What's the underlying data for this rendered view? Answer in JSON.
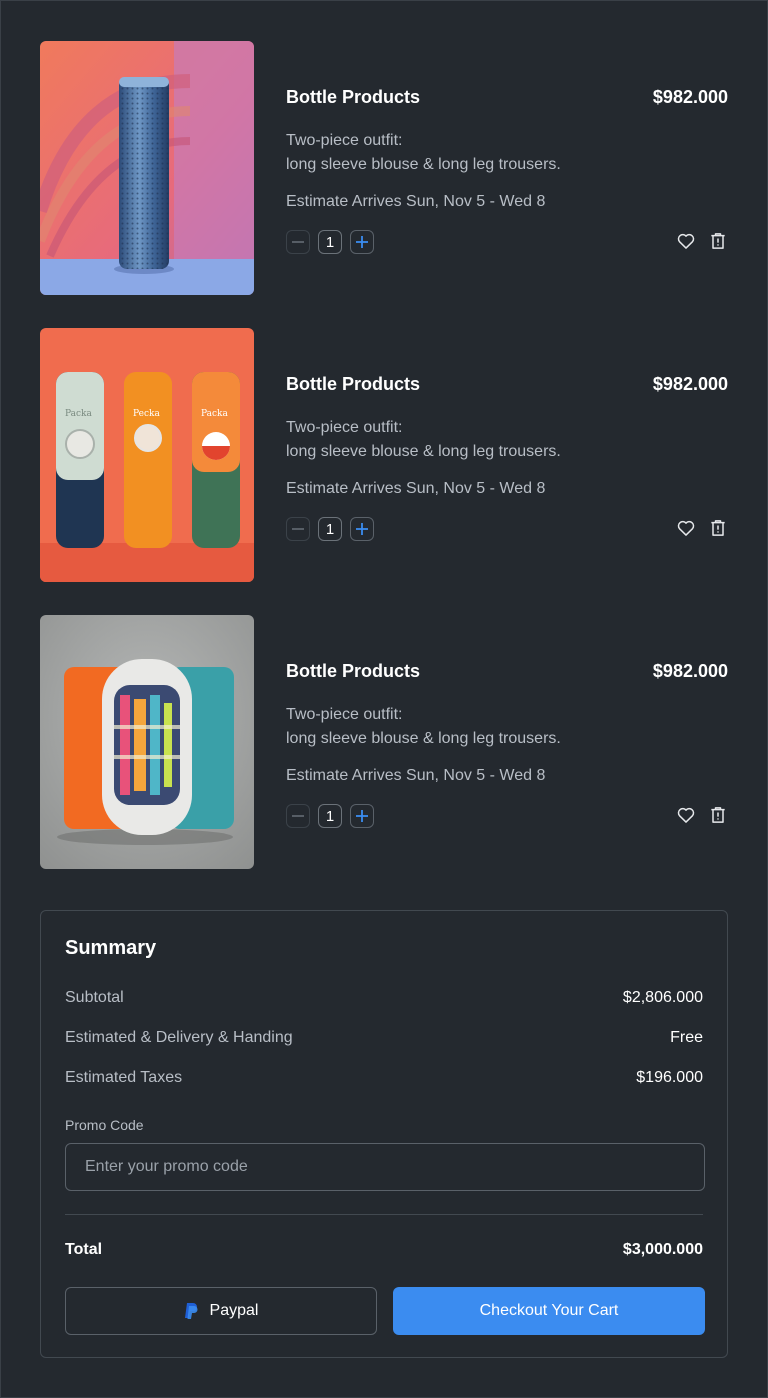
{
  "cart": {
    "items": [
      {
        "title": "Bottle Products",
        "price": "$982.000",
        "desc_line1": "Two-piece outfit:",
        "desc_line2": "long sleeve blouse & long leg trousers.",
        "eta": "Estimate Arrives Sun, Nov 5 - Wed 8",
        "quantity": "1",
        "image": "blue metallic bottle product photo"
      },
      {
        "title": "Bottle Products",
        "price": "$982.000",
        "desc_line1": "Two-piece outfit:",
        "desc_line2": "long sleeve blouse & long leg trousers.",
        "eta": "Estimate Arrives Sun, Nov 5 - Wed 8",
        "quantity": "1",
        "image": "three colorful bottles product photo",
        "bottle_labels": [
          "Packa",
          "Pecka",
          "Packa"
        ]
      },
      {
        "title": "Bottle Products",
        "price": "$982.000",
        "desc_line1": "Two-piece outfit:",
        "desc_line2": "long sleeve blouse & long leg trousers.",
        "eta": "Estimate Arrives Sun, Nov 5 - Wed 8",
        "quantity": "1",
        "image": "orange and teal capsule container product photo"
      }
    ]
  },
  "summary": {
    "title": "Summary",
    "subtotal_label": "Subtotal",
    "subtotal_value": "$2,806.000",
    "delivery_label": "Estimated & Delivery & Handing",
    "delivery_value": "Free",
    "taxes_label": "Estimated Taxes",
    "taxes_value": "$196.000",
    "promo_label": "Promo Code",
    "promo_placeholder": "Enter your promo code",
    "promo_value": "",
    "total_label": "Total",
    "total_value": "$3,000.000",
    "paypal_label": "Paypal",
    "checkout_label": "Checkout Your Cart"
  },
  "colors": {
    "background": "#24292f",
    "accent": "#3b8cf0",
    "muted_text": "#b8bec6",
    "border": "#424950"
  },
  "icons": [
    "minus-icon",
    "plus-icon",
    "heart-icon",
    "trash-icon",
    "paypal-icon"
  ]
}
